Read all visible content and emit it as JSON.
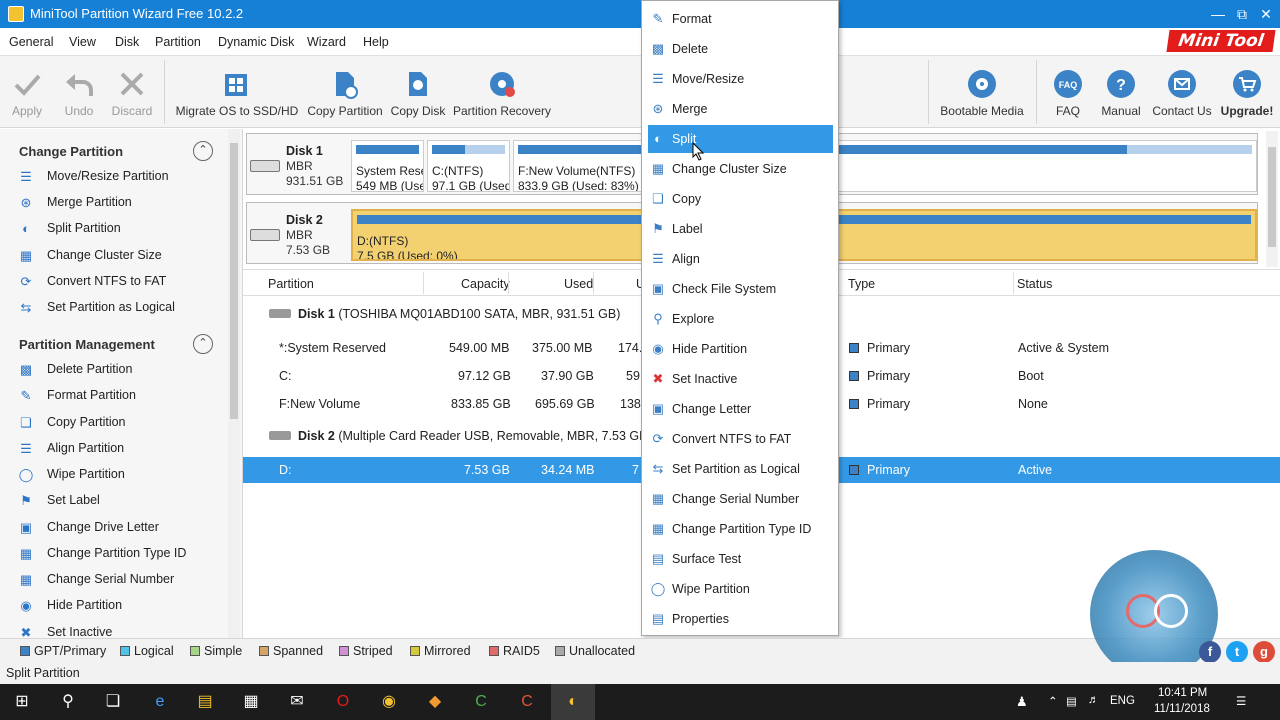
{
  "window": {
    "title": "MiniTool Partition Wizard Free 10.2.2",
    "logo": "Mini Tool"
  },
  "menu": [
    "General",
    "View",
    "Disk",
    "Partition",
    "Dynamic Disk",
    "Wizard",
    "Help"
  ],
  "toolbar": {
    "apply": "Apply",
    "undo": "Undo",
    "discard": "Discard",
    "migrate": "Migrate OS to SSD/HD",
    "copy_partition": "Copy Partition",
    "copy_disk": "Copy Disk",
    "partition_recovery": "Partition Recovery",
    "bootable": "Bootable Media",
    "faq": "FAQ",
    "manual": "Manual",
    "contact": "Contact Us",
    "upgrade": "Upgrade!"
  },
  "sidebar": {
    "section1": "Change Partition",
    "items1": [
      "Move/Resize Partition",
      "Merge Partition",
      "Split Partition",
      "Change Cluster Size",
      "Convert NTFS to FAT",
      "Set Partition as Logical"
    ],
    "section2": "Partition Management",
    "items2": [
      "Delete Partition",
      "Format Partition",
      "Copy Partition",
      "Align Partition",
      "Wipe Partition",
      "Set Label",
      "Change Drive Letter",
      "Change Partition Type ID",
      "Change Serial Number",
      "Hide Partition",
      "Set Inactive"
    ]
  },
  "diskmap": {
    "disk1": {
      "name": "Disk 1",
      "type": "MBR",
      "size": "931.51 GB",
      "p1": {
        "label": "System Rese",
        "info": "549 MB (Use"
      },
      "p2": {
        "label": "C:(NTFS)",
        "info": "97.1 GB (Used"
      },
      "p3": {
        "label": "F:New Volume(NTFS)",
        "info": "833.9 GB (Used: 83%)"
      }
    },
    "disk2": {
      "name": "Disk 2",
      "type": "MBR",
      "size": "7.53 GB",
      "p1": {
        "label": "D:(NTFS)",
        "info": "7.5 GB (Used: 0%)"
      }
    }
  },
  "table": {
    "headers": {
      "partition": "Partition",
      "capacity": "Capacity",
      "used": "Used",
      "unused": "U",
      "type": "Type",
      "status": "Status"
    },
    "disk1_label": "Disk 1",
    "disk1_desc": "(TOSHIBA MQ01ABD100 SATA, MBR, 931.51 GB)",
    "disk2_label": "Disk 2",
    "disk2_desc": "(Multiple Card Reader USB, Removable, MBR, 7.53 GB)",
    "rows": [
      {
        "name": "*:System Reserved",
        "capacity": "549.00 MB",
        "used": "375.00 MB",
        "unused": "174.",
        "type": "Primary",
        "status": "Active & System"
      },
      {
        "name": "C:",
        "capacity": "97.12 GB",
        "used": "37.90 GB",
        "unused": "59",
        "type": "Primary",
        "status": "Boot"
      },
      {
        "name": "F:New Volume",
        "capacity": "833.85 GB",
        "used": "695.69 GB",
        "unused": "138",
        "type": "Primary",
        "status": "None"
      },
      {
        "name": "D:",
        "capacity": "7.53 GB",
        "used": "34.24 MB",
        "unused": "7",
        "type": "Primary",
        "status": "Active"
      }
    ]
  },
  "context_menu": [
    "Format",
    "Delete",
    "Move/Resize",
    "Merge",
    "Split",
    "Change Cluster Size",
    "Copy",
    "Label",
    "Align",
    "Check File System",
    "Explore",
    "Hide Partition",
    "Set Inactive",
    "Change Letter",
    "Convert NTFS to FAT",
    "Set Partition as Logical",
    "Change Serial Number",
    "Change Partition Type ID",
    "Surface Test",
    "Wipe Partition",
    "Properties"
  ],
  "legend": [
    "GPT/Primary",
    "Logical",
    "Simple",
    "Spanned",
    "Striped",
    "Mirrored",
    "RAID5",
    "Unallocated"
  ],
  "legend_colors": [
    "#3b83c6",
    "#4fc3e8",
    "#a6d58a",
    "#d4a36a",
    "#d18fd4",
    "#d4c93a",
    "#e06a6a",
    "#aaaaaa"
  ],
  "status": "Split Partition",
  "taskbar": {
    "lang": "ENG",
    "time": "10:41 PM",
    "date": "11/11/2018"
  }
}
